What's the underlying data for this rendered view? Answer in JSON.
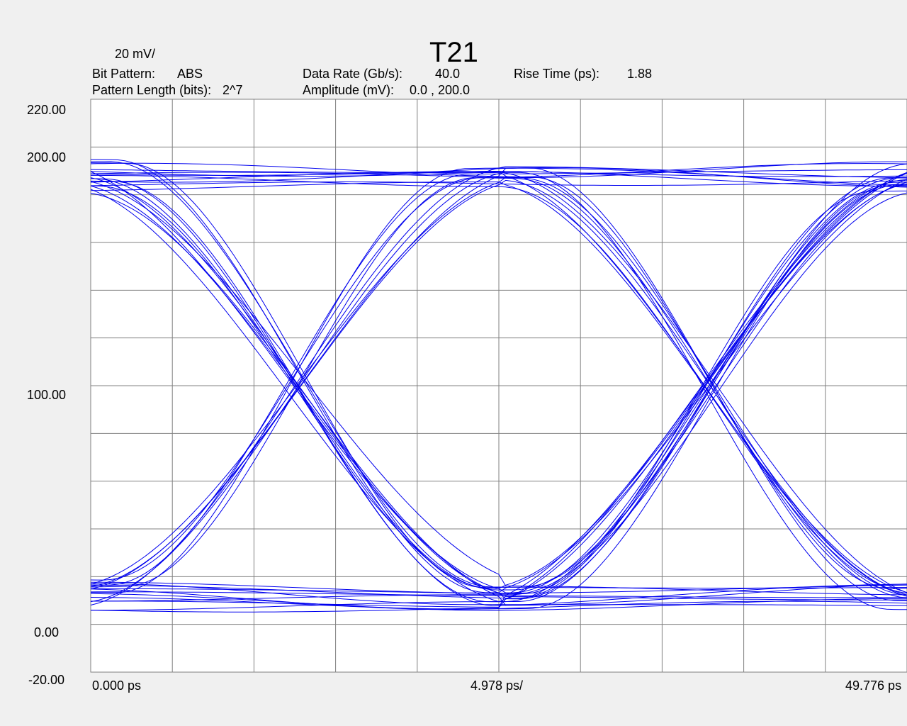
{
  "header": {
    "title": "T21",
    "scale": "20 mV/",
    "bit_pattern_label": "Bit Pattern:",
    "bit_pattern_value": "ABS",
    "pattern_length_label": "Pattern Length (bits):",
    "pattern_length_value": "2^7",
    "data_rate_label": "Data Rate (Gb/s):",
    "data_rate_value": "40.0",
    "amplitude_label": "Amplitude (mV):",
    "amplitude_value": "0.0 , 200.0",
    "rise_time_label": "Rise Time (ps):",
    "rise_time_value": "1.88"
  },
  "colors": {
    "trace": "#0000ee",
    "grid": "#808080",
    "plot_bg": "#ffffff",
    "page_bg": "#f0f0f0"
  },
  "chart_data": {
    "type": "line",
    "subtype": "eye-diagram",
    "title": "T21",
    "ylim": [
      -20,
      220
    ],
    "xlim": [
      0,
      49.776
    ],
    "x_divisions": 10,
    "y_divisions": 12,
    "grid": true,
    "y_tick_labels": [
      "220.00",
      "200.00",
      "100.00",
      "0.00",
      "-20.00"
    ],
    "y_tick_values": [
      220,
      200,
      100,
      0,
      -20
    ],
    "x_tick_labels": [
      "0.000 ps",
      "4.978 ps/",
      "49.776 ps"
    ],
    "levels": {
      "high": 188,
      "low": 12
    },
    "crossings_ps": [
      12.6,
      37.6
    ],
    "crossing_level": 100,
    "unit_interval_ps": 25.0
  }
}
